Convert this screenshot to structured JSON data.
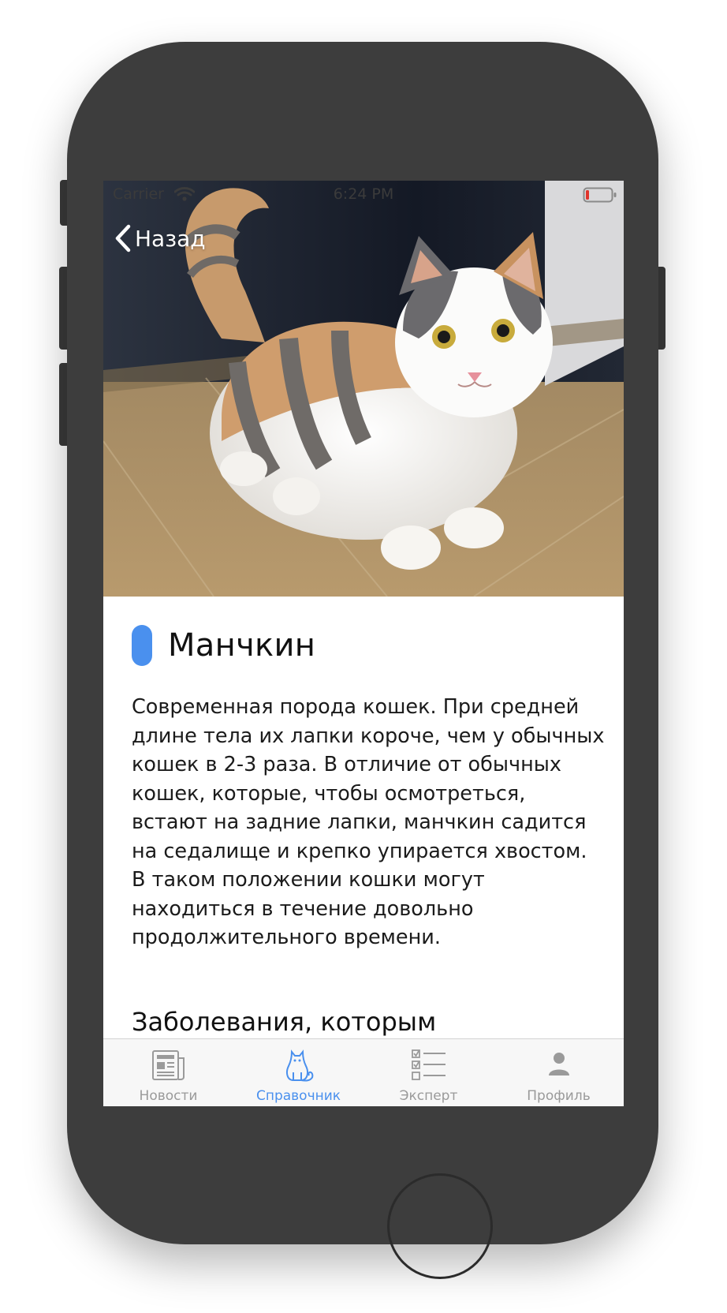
{
  "status_bar": {
    "carrier": "Carrier",
    "time": "6:24 PM"
  },
  "nav": {
    "back_label": "Назад"
  },
  "breed": {
    "name": "Манчкин",
    "description": "Современная порода кошек. При средней длине тела их лапки короче, чем у обычных кошек в 2-3 раза. В отличие от обычных кошек, которые, чтобы осмотреться, встают на задние лапки, манчкин садится на седалище и крепко упирается хвостом. В таком положении кошки могут находиться в течение довольно продолжительного времени.",
    "section_heading": "Заболевания, которым"
  },
  "tabs": [
    {
      "label": "Новости",
      "icon": "newspaper-icon",
      "active": false
    },
    {
      "label": "Справочник",
      "icon": "cat-icon",
      "active": true
    },
    {
      "label": "Эксперт",
      "icon": "checklist-icon",
      "active": false
    },
    {
      "label": "Профиль",
      "icon": "person-icon",
      "active": false
    }
  ],
  "colors": {
    "accent": "#4a90ee",
    "frame": "#3d3d3d",
    "tab_inactive": "#9a9a9a",
    "battery_low": "#e0342c"
  }
}
